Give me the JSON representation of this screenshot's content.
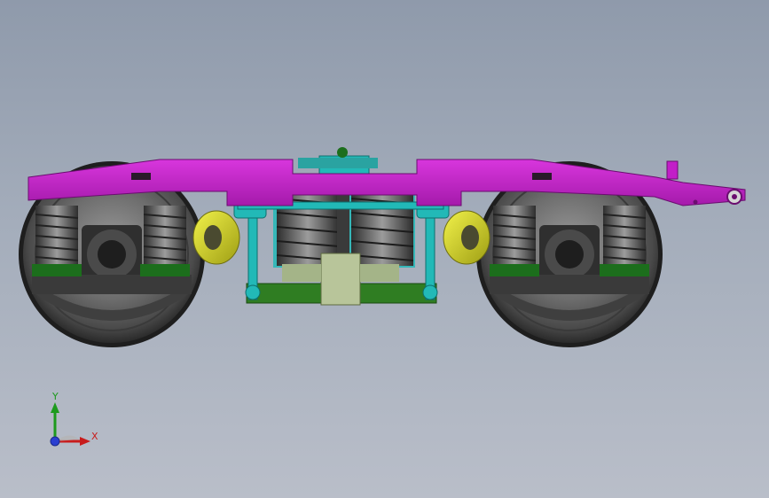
{
  "viewport": {
    "background_top": "#8f9aab",
    "background_bottom": "#b9bec9"
  },
  "model": {
    "subject": "railway-bogie",
    "colors": {
      "frame": "#c21ec8",
      "frame_shadow": "#8e1494",
      "springs": "#4a4a4a",
      "wheels": "#3a3a3a",
      "axlebox": "#2f2f2f",
      "cyan_parts": "#22b9b7",
      "green_parts": "#2f7d22",
      "spring_seat": "#1c6e1c",
      "yellow_parts": "#d6d62a"
    }
  },
  "triad": {
    "y_label": "Y",
    "x_label": "X",
    "y_color": "#1d9a1d",
    "x_color": "#c81c1c",
    "z_color": "#2a3fd1"
  }
}
